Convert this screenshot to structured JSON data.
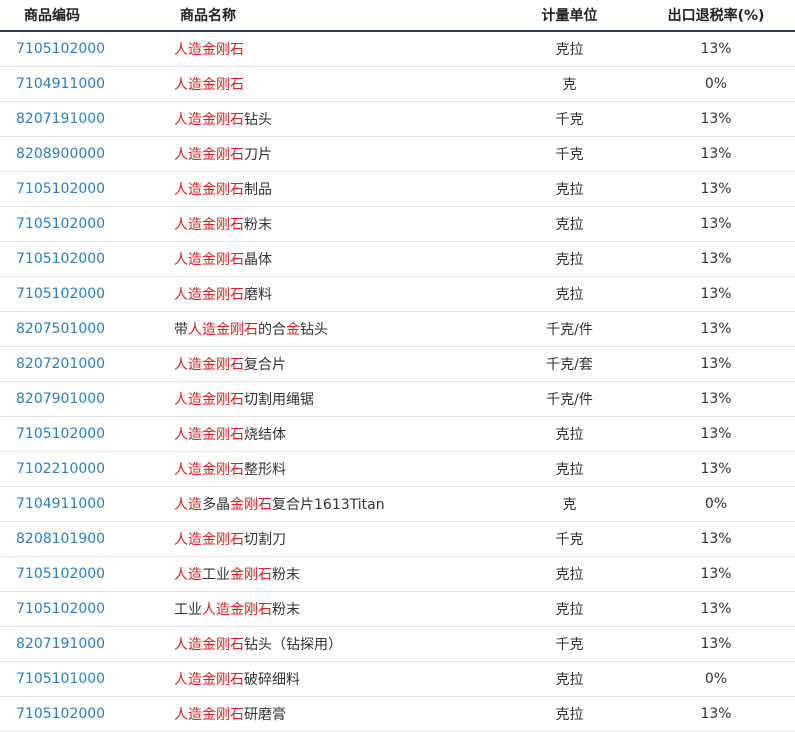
{
  "table": {
    "headers": {
      "code": "商品编码",
      "name": "商品名称",
      "unit": "计量单位",
      "rate": "出口退税率(%)"
    },
    "rows": [
      {
        "code": "7105102000",
        "name": [
          {
            "t": "人造金刚石",
            "hl": true
          }
        ],
        "unit": "克拉",
        "rate": "13%"
      },
      {
        "code": "7104911000",
        "name": [
          {
            "t": "人造金刚石",
            "hl": true
          }
        ],
        "unit": "克",
        "rate": "0%"
      },
      {
        "code": "8207191000",
        "name": [
          {
            "t": "人造金刚石",
            "hl": true
          },
          {
            "t": "钻头",
            "hl": false
          }
        ],
        "unit": "千克",
        "rate": "13%"
      },
      {
        "code": "8208900000",
        "name": [
          {
            "t": "人造金刚石",
            "hl": true
          },
          {
            "t": "刀片",
            "hl": false
          }
        ],
        "unit": "千克",
        "rate": "13%"
      },
      {
        "code": "7105102000",
        "name": [
          {
            "t": "人造金刚石",
            "hl": true
          },
          {
            "t": "制品",
            "hl": false
          }
        ],
        "unit": "克拉",
        "rate": "13%"
      },
      {
        "code": "7105102000",
        "name": [
          {
            "t": "人造金刚石",
            "hl": true
          },
          {
            "t": "粉末",
            "hl": false
          }
        ],
        "unit": "克拉",
        "rate": "13%"
      },
      {
        "code": "7105102000",
        "name": [
          {
            "t": "人造金刚石",
            "hl": true
          },
          {
            "t": "晶体",
            "hl": false
          }
        ],
        "unit": "克拉",
        "rate": "13%"
      },
      {
        "code": "7105102000",
        "name": [
          {
            "t": "人造金刚石",
            "hl": true
          },
          {
            "t": "磨料",
            "hl": false
          }
        ],
        "unit": "克拉",
        "rate": "13%"
      },
      {
        "code": "8207501000",
        "name": [
          {
            "t": "带",
            "hl": false
          },
          {
            "t": "人造金刚石",
            "hl": true
          },
          {
            "t": "的合",
            "hl": false
          },
          {
            "t": "金",
            "hl": true
          },
          {
            "t": "钻头",
            "hl": false
          }
        ],
        "unit": "千克/件",
        "rate": "13%"
      },
      {
        "code": "8207201000",
        "name": [
          {
            "t": "人造金刚石",
            "hl": true
          },
          {
            "t": "复合片",
            "hl": false
          }
        ],
        "unit": "千克/套",
        "rate": "13%"
      },
      {
        "code": "8207901000",
        "name": [
          {
            "t": "人造金刚石",
            "hl": true
          },
          {
            "t": "切割用绳锯",
            "hl": false
          }
        ],
        "unit": "千克/件",
        "rate": "13%"
      },
      {
        "code": "7105102000",
        "name": [
          {
            "t": "人造金刚石",
            "hl": true
          },
          {
            "t": "烧结体",
            "hl": false
          }
        ],
        "unit": "克拉",
        "rate": "13%"
      },
      {
        "code": "7102210000",
        "name": [
          {
            "t": "人造金刚石",
            "hl": true
          },
          {
            "t": "整形料",
            "hl": false
          }
        ],
        "unit": "克拉",
        "rate": "13%"
      },
      {
        "code": "7104911000",
        "name": [
          {
            "t": "人造",
            "hl": true
          },
          {
            "t": "多晶",
            "hl": false
          },
          {
            "t": "金刚石",
            "hl": true
          },
          {
            "t": "复合片1613Titan",
            "hl": false
          }
        ],
        "unit": "克",
        "rate": "0%"
      },
      {
        "code": "8208101900",
        "name": [
          {
            "t": "人造金刚石",
            "hl": true
          },
          {
            "t": "切割刀",
            "hl": false
          }
        ],
        "unit": "千克",
        "rate": "13%"
      },
      {
        "code": "7105102000",
        "name": [
          {
            "t": "人造",
            "hl": true
          },
          {
            "t": "工业",
            "hl": false
          },
          {
            "t": "金刚石",
            "hl": true
          },
          {
            "t": "粉末",
            "hl": false
          }
        ],
        "unit": "克拉",
        "rate": "13%"
      },
      {
        "code": "7105102000",
        "name": [
          {
            "t": "工业",
            "hl": false
          },
          {
            "t": "人造金刚石",
            "hl": true
          },
          {
            "t": "粉末",
            "hl": false
          }
        ],
        "unit": "克拉",
        "rate": "13%"
      },
      {
        "code": "8207191000",
        "name": [
          {
            "t": "人造金刚石",
            "hl": true
          },
          {
            "t": "钻头（钻探用）",
            "hl": false
          }
        ],
        "unit": "千克",
        "rate": "13%"
      },
      {
        "code": "7105101000",
        "name": [
          {
            "t": "人造金刚石",
            "hl": true
          },
          {
            "t": "破碎细料",
            "hl": false
          }
        ],
        "unit": "克拉",
        "rate": "0%"
      },
      {
        "code": "7105102000",
        "name": [
          {
            "t": "人造金刚石",
            "hl": true
          },
          {
            "t": "研磨膏",
            "hl": false
          }
        ],
        "unit": "克拉",
        "rate": "13%"
      }
    ]
  }
}
